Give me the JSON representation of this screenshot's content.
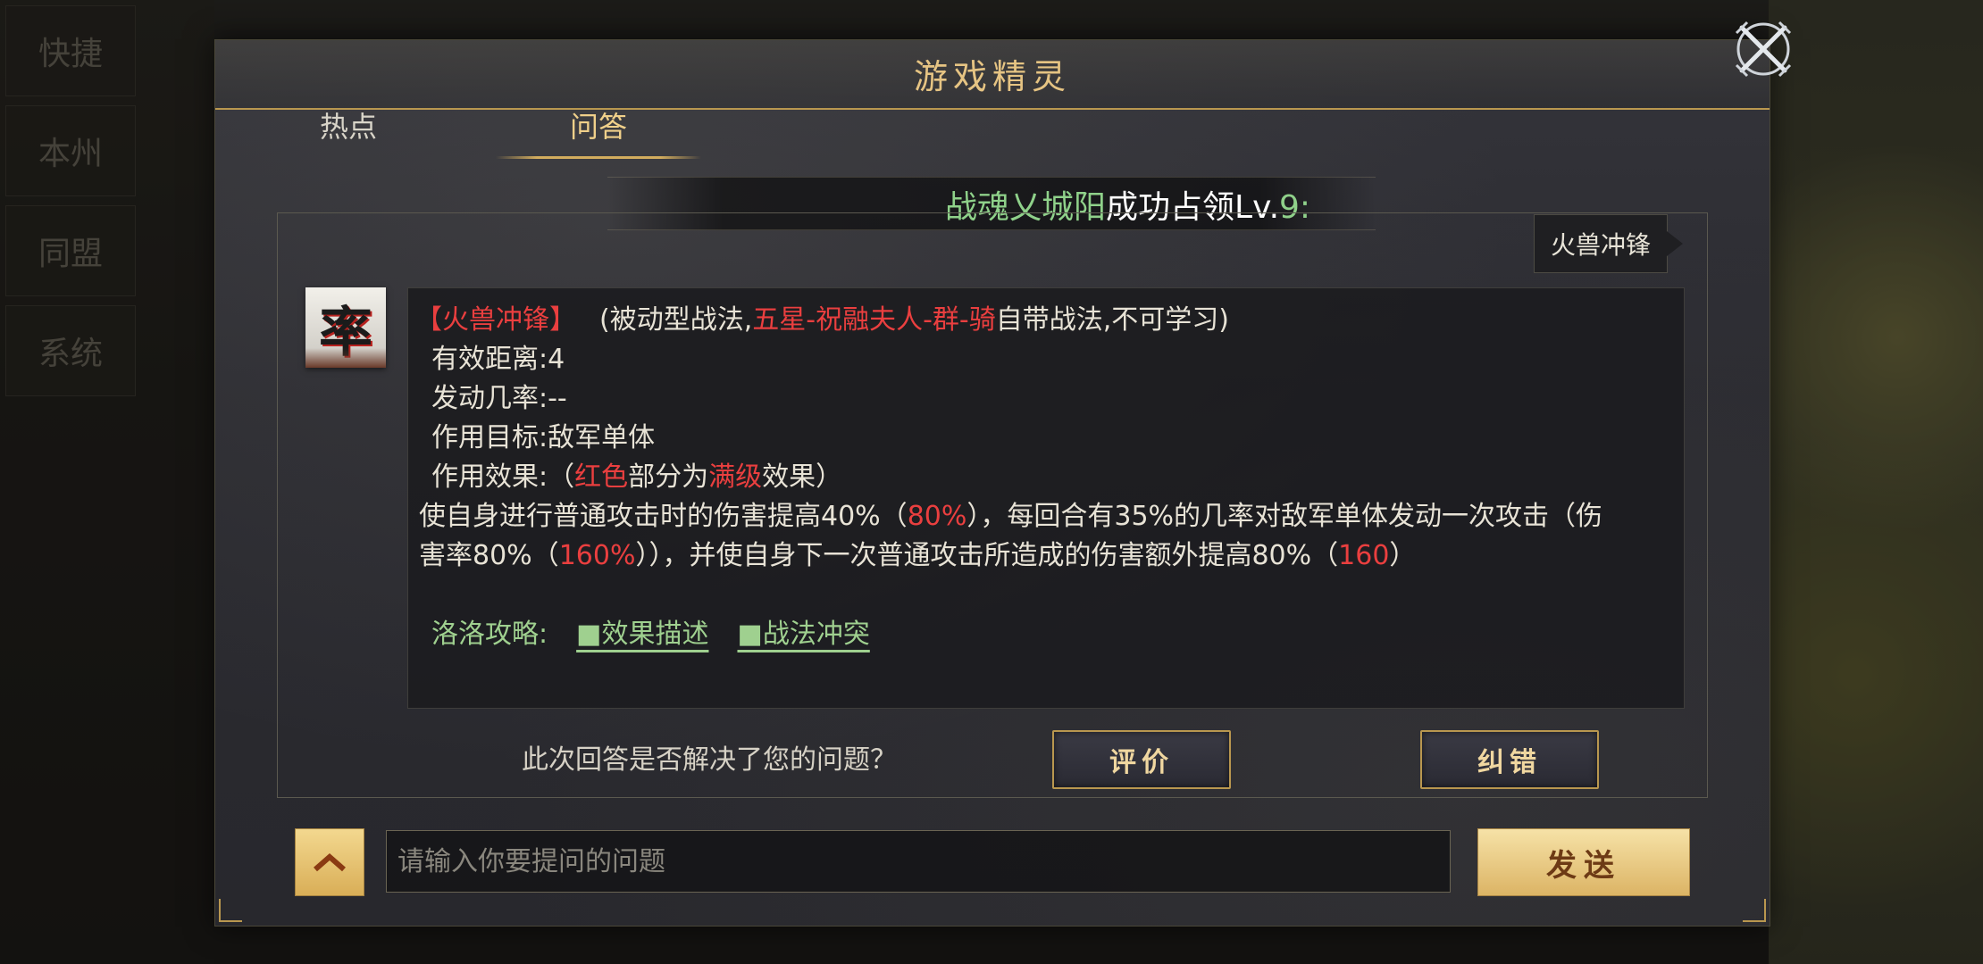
{
  "dialog": {
    "title": "游戏精灵",
    "close_icon": "crossed-swords-close-icon"
  },
  "tabs": [
    {
      "label": "热点",
      "active": false
    },
    {
      "label": "问答",
      "active": true
    }
  ],
  "marquee": {
    "player": "战魂乂城阳",
    "action": "成功占领Lv.",
    "level": "9:"
  },
  "keyword_tag": "火兽冲锋",
  "avatar_char": "率",
  "answer": {
    "skill_name": "【火兽冲锋】",
    "paren_open": "(被动型战法,",
    "paren_red": "五星-祝融夫人-群-骑",
    "paren_close": "自带战法,不可学习)",
    "range": "有效距离:4",
    "rate": "发动几率:--",
    "target": "作用目标:敌军单体",
    "effect_a": "作用效果:（",
    "effect_red1": "红色",
    "effect_b": "部分为",
    "effect_red2": "满级",
    "effect_c": "效果）",
    "desc1_a": "使自身进行普通攻击时的伤害提高40%（",
    "desc1_red": "80%",
    "desc1_b": "），每回合有35%的几率对敌军单体发动一次攻击（伤",
    "desc2_a": "害率80%（",
    "desc2_red": "160%",
    "desc2_b": "）），并使自身下一次普通攻击所造成的伤害额外提高80%（",
    "desc2_red2": "160",
    "desc2_c": "）",
    "guide_label": "洛洛攻略:",
    "guide_links": [
      "■效果描述",
      "■战法冲突"
    ]
  },
  "feedback": {
    "question": "此次回答是否解决了您的问题？",
    "rate_label": "评价",
    "correct_label": "纠错"
  },
  "input": {
    "placeholder": "请输入你要提问的问题",
    "send_label": "发送",
    "expand_icon": "chevron-up-icon"
  },
  "sidebar": [
    "快捷",
    "本州",
    "同盟",
    "系统"
  ],
  "colors": {
    "gold": "#e6c483",
    "red": "#ea3f3f",
    "green": "#8fd18a"
  }
}
